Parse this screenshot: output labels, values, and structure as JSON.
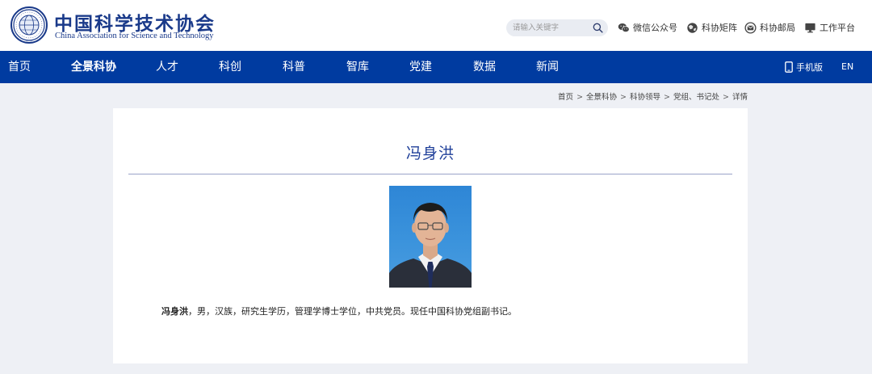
{
  "header": {
    "logo_cn": "中国科学技术协会",
    "logo_en": "China Association for Science and Technology",
    "search_placeholder": "请输入关键字",
    "tools": {
      "wechat": "微信公众号",
      "matrix": "科协矩阵",
      "mail": "科协邮局",
      "work": "工作平台"
    }
  },
  "nav": {
    "items": [
      "首页",
      "全景科协",
      "人才",
      "科创",
      "科普",
      "智库",
      "党建",
      "数据",
      "新闻"
    ],
    "active_index": 1,
    "mobile": "手机版",
    "en": "EN"
  },
  "breadcrumb": [
    "首页",
    "全景科协",
    "科协领导",
    "党组、书记处",
    "详情"
  ],
  "profile": {
    "name": "冯身洪",
    "bio_name": "冯身洪",
    "bio_text": "，男，汉族，研究生学历，管理学博士学位，中共党员。现任中国科协党组副书记。"
  },
  "colors": {
    "nav_bg": "#003ba0",
    "brand": "#1a3a8a",
    "title": "#1f3f99",
    "page_bg": "#eef0f5"
  }
}
